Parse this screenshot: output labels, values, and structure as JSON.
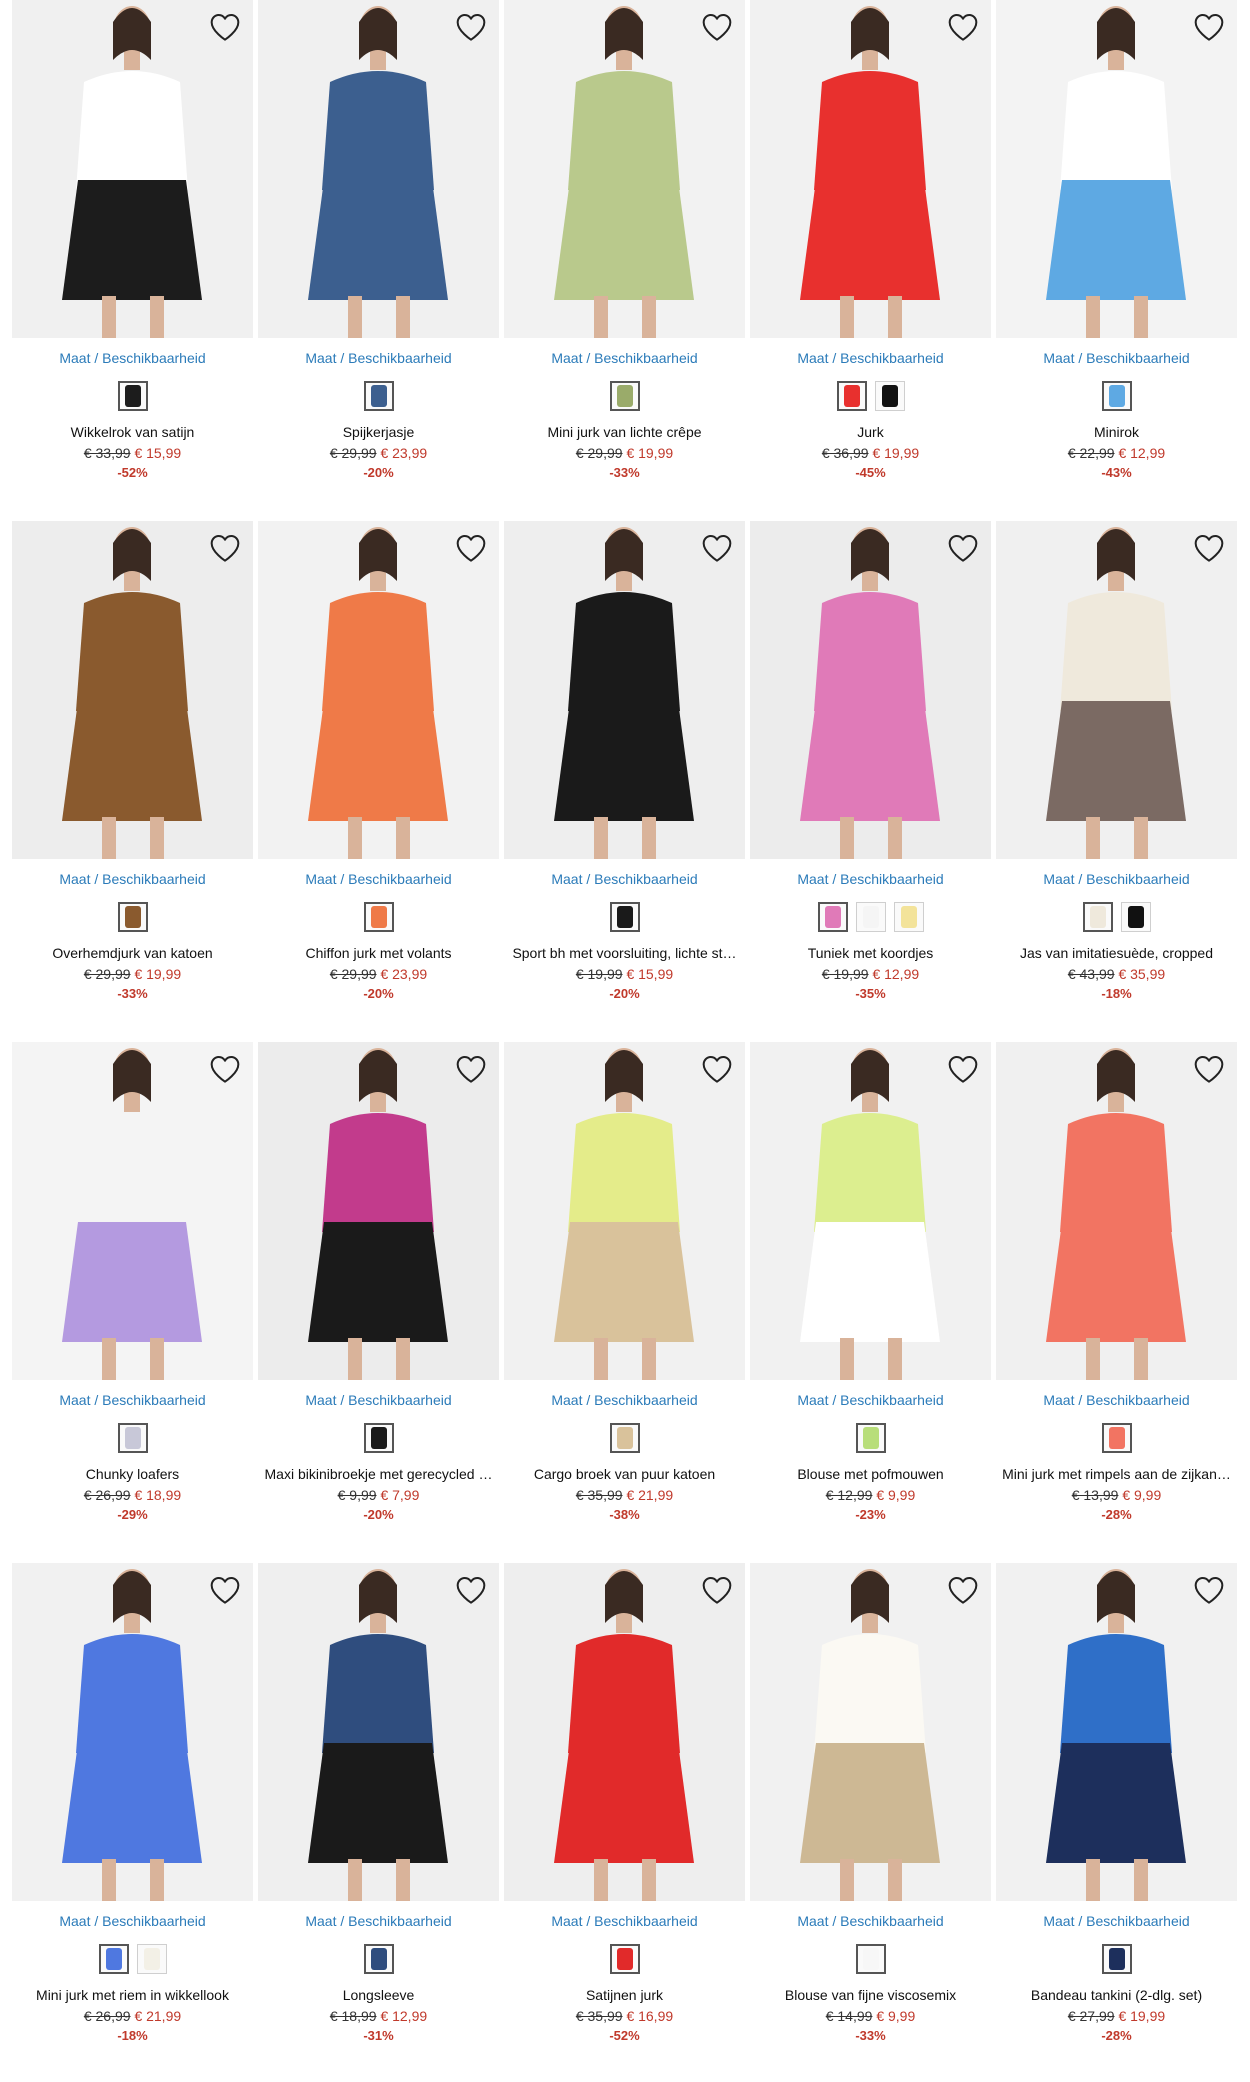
{
  "labels": {
    "size_link": "Maat / Beschikbaarheid"
  },
  "icons": {
    "wishlist": "heart-outline-icon"
  },
  "colors": {
    "link": "#2b7bb9",
    "sale": "#c0392b"
  },
  "products": [
    {
      "name": "Wikkelrok van satijn",
      "old_price": "€ 33,99",
      "new_price": "€ 15,99",
      "discount": "-52%",
      "bg": "#f0f0f0",
      "main": "#1c1c1c",
      "top": "#ffffff",
      "swatches": [
        "#1c1c1c"
      ]
    },
    {
      "name": "Spijkerjasje",
      "old_price": "€ 29,99",
      "new_price": "€ 23,99",
      "discount": "-20%",
      "bg": "#f0f0f0",
      "main": "#3c5f8f",
      "top": "#3c5f8f",
      "swatches": [
        "#3c5f8f"
      ]
    },
    {
      "name": "Mini jurk van lichte crêpe",
      "old_price": "€ 29,99",
      "new_price": "€ 19,99",
      "discount": "-33%",
      "bg": "#f2f2f2",
      "main": "#b9c98c",
      "top": "#b9c98c",
      "swatches": [
        "#9aab6a"
      ]
    },
    {
      "name": "Jurk",
      "old_price": "€ 36,99",
      "new_price": "€ 19,99",
      "discount": "-45%",
      "bg": "#f1f1f1",
      "main": "#e8302e",
      "top": "#e8302e",
      "swatches": [
        "#e8302e",
        "#111111"
      ]
    },
    {
      "name": "Minirok",
      "old_price": "€ 22,99",
      "new_price": "€ 12,99",
      "discount": "-43%",
      "bg": "#f3f3f3",
      "main": "#5ea9e3",
      "top": "#ffffff",
      "swatches": [
        "#5ea9e3"
      ]
    },
    {
      "name": "Overhemdjurk van katoen",
      "old_price": "€ 29,99",
      "new_price": "€ 19,99",
      "discount": "-33%",
      "bg": "#ededed",
      "main": "#8a5a2e",
      "top": "#8a5a2e",
      "swatches": [
        "#8a5a2e"
      ]
    },
    {
      "name": "Chiffon jurk met volants",
      "old_price": "€ 29,99",
      "new_price": "€ 23,99",
      "discount": "-20%",
      "bg": "#f2f2f2",
      "main": "#ef7a48",
      "top": "#ef7a48",
      "swatches": [
        "#ef7a48"
      ]
    },
    {
      "name": "Sport bh met voorsluiting, lichte st…",
      "old_price": "€ 19,99",
      "new_price": "€ 15,99",
      "discount": "-20%",
      "bg": "#eeeeee",
      "main": "#1a1a1a",
      "top": "#1a1a1a",
      "swatches": [
        "#1a1a1a"
      ]
    },
    {
      "name": "Tuniek met koordjes",
      "old_price": "€ 19,99",
      "new_price": "€ 12,99",
      "discount": "-35%",
      "bg": "#ececec",
      "main": "#e07ab8",
      "top": "#e07ab8",
      "swatches": [
        "#e07ab8",
        "#f5f5f5",
        "#f3e39a"
      ]
    },
    {
      "name": "Jas van imitatiesuède, cropped",
      "old_price": "€ 43,99",
      "new_price": "€ 35,99",
      "discount": "-18%",
      "bg": "#f0f0f0",
      "main": "#7b6a63",
      "top": "#efe9dc",
      "swatches": [
        "#efe9dc",
        "#111111"
      ]
    },
    {
      "name": "Chunky loafers",
      "old_price": "€ 26,99",
      "new_price": "€ 18,99",
      "discount": "-29%",
      "bg": "#f4f4f4",
      "main": "#b49ae0",
      "top": "#f4f4f4",
      "swatches": [
        "#c8c8d8"
      ]
    },
    {
      "name": "Maxi bikinibroekje met gerecycled …",
      "old_price": "€ 9,99",
      "new_price": "€ 7,99",
      "discount": "-20%",
      "bg": "#ececec",
      "main": "#1a1a1a",
      "top": "#c23b8c",
      "swatches": [
        "#1a1a1a"
      ]
    },
    {
      "name": "Cargo broek van puur katoen",
      "old_price": "€ 35,99",
      "new_price": "€ 21,99",
      "discount": "-38%",
      "bg": "#f1f1f1",
      "main": "#d9c29b",
      "top": "#e4ec8a",
      "swatches": [
        "#d9c29b"
      ]
    },
    {
      "name": "Blouse met pofmouwen",
      "old_price": "€ 12,99",
      "new_price": "€ 9,99",
      "discount": "-23%",
      "bg": "#f1f1f1",
      "main": "#ffffff",
      "top": "#dcee8f",
      "swatches": [
        "#b8de7a"
      ]
    },
    {
      "name": "Mini jurk met rimpels aan de zijkan…",
      "old_price": "€ 13,99",
      "new_price": "€ 9,99",
      "discount": "-28%",
      "bg": "#f0f0f0",
      "main": "#f27462",
      "top": "#f27462",
      "swatches": [
        "#f27462"
      ]
    },
    {
      "name": "Mini jurk met riem in wikkellook",
      "old_price": "€ 26,99",
      "new_price": "€ 21,99",
      "discount": "-18%",
      "bg": "#f1f1f1",
      "main": "#4f78e0",
      "top": "#4f78e0",
      "swatches": [
        "#4f78e0",
        "#f3f0e6"
      ]
    },
    {
      "name": "Longsleeve",
      "old_price": "€ 18,99",
      "new_price": "€ 12,99",
      "discount": "-31%",
      "bg": "#efefef",
      "main": "#1a1a1a",
      "top": "#2f4d7e",
      "swatches": [
        "#2f4d7e"
      ]
    },
    {
      "name": "Satijnen jurk",
      "old_price": "€ 35,99",
      "new_price": "€ 16,99",
      "discount": "-52%",
      "bg": "#eeeeee",
      "main": "#e12a2a",
      "top": "#e12a2a",
      "swatches": [
        "#e12a2a"
      ]
    },
    {
      "name": "Blouse van fijne viscosemix",
      "old_price": "€ 14,99",
      "new_price": "€ 9,99",
      "discount": "-33%",
      "bg": "#f1f1f1",
      "main": "#cdb894",
      "top": "#fbf9f3",
      "swatches": [
        "#f7f7f7"
      ]
    },
    {
      "name": "Bandeau tankini (2-dlg. set)",
      "old_price": "€ 27,99",
      "new_price": "€ 19,99",
      "discount": "-28%",
      "bg": "#f1f1f1",
      "main": "#1d2f5c",
      "top": "#2f6fc8",
      "swatches": [
        "#1d2f5c"
      ]
    }
  ]
}
